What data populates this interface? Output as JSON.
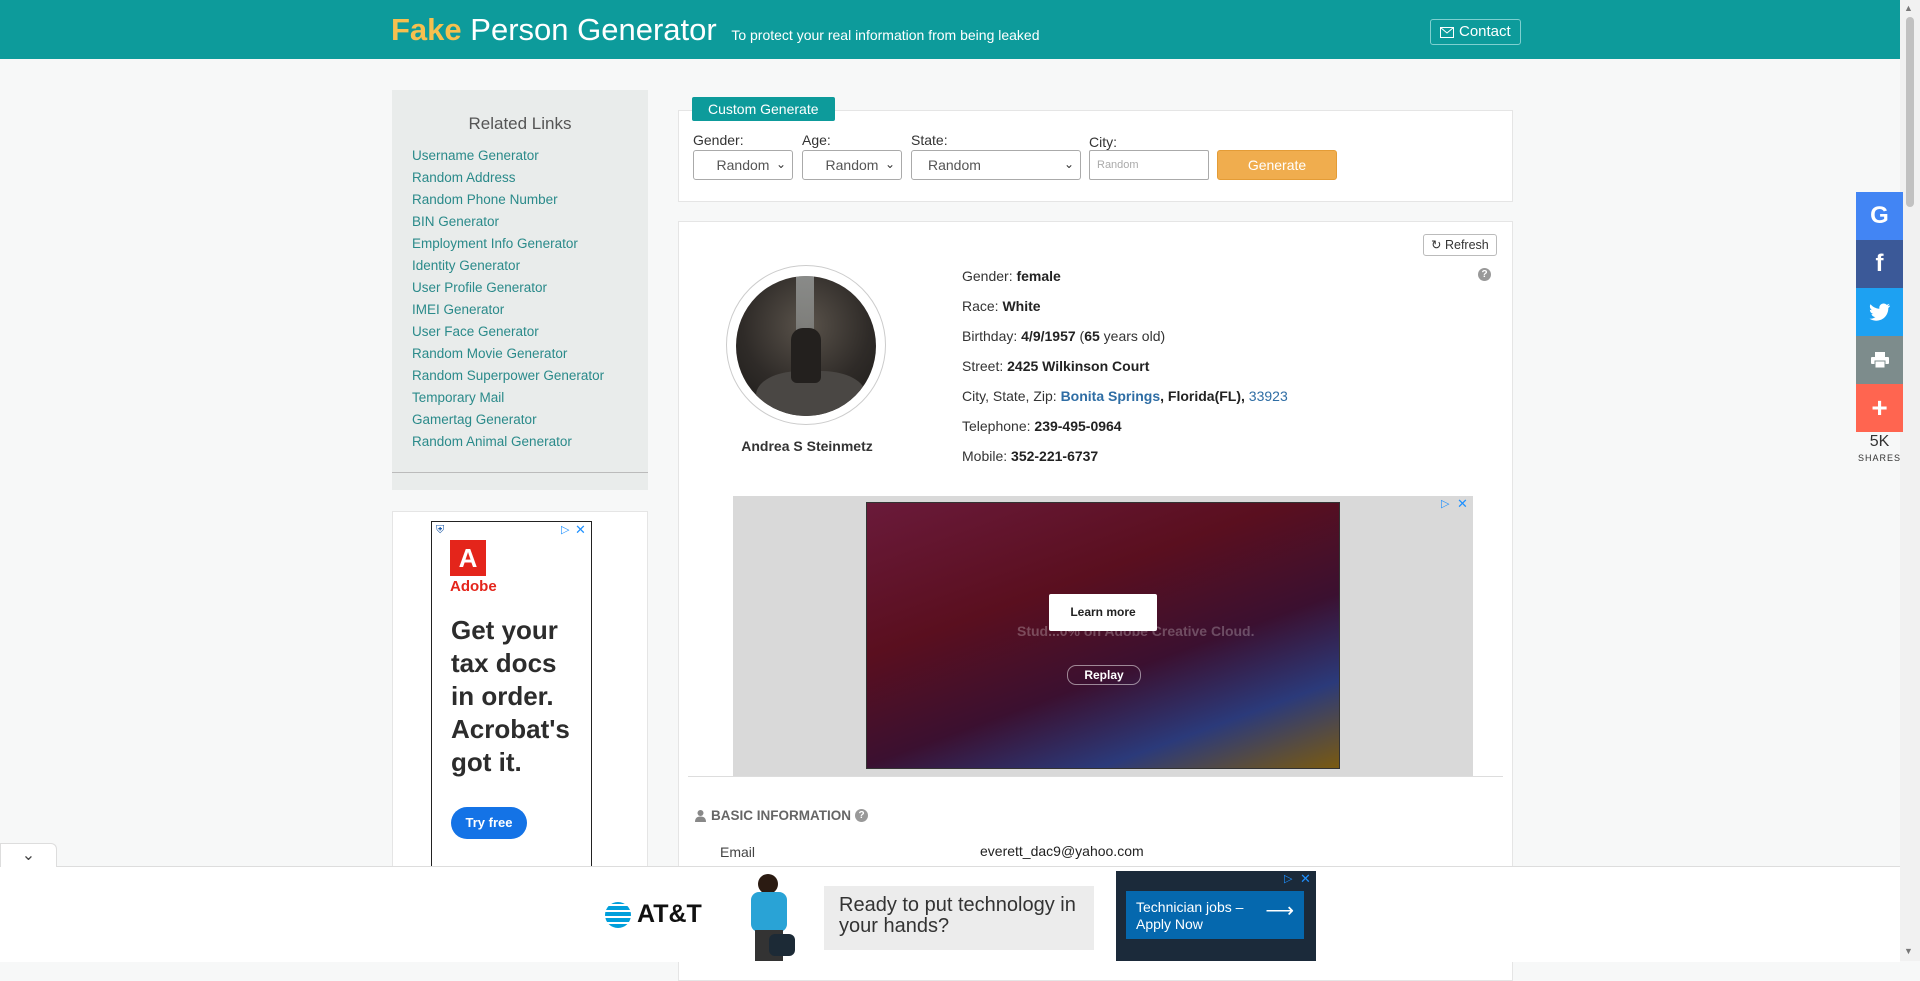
{
  "header": {
    "brand_fake": "Fake",
    "brand_rest": "Person Generator",
    "tagline": "To protect your real information from being leaked",
    "contact_label": "Contact"
  },
  "sidebar": {
    "title": "Related Links",
    "links": [
      "Username Generator",
      "Random Address",
      "Random Phone Number",
      "BIN Generator",
      "Employment Info Generator",
      "Identity Generator",
      "User Profile Generator",
      "IMEI Generator",
      "User Face Generator",
      "Random Movie Generator",
      "Random Superpower Generator",
      "Temporary Mail",
      "Gamertag Generator",
      "Random Animal Generator"
    ]
  },
  "side_ad": {
    "brand": "Adobe",
    "headline": "Get your tax docs in order. Acrobat's got it.",
    "cta": "Try free"
  },
  "custom_generate": {
    "tab_label": "Custom Generate",
    "gender_label": "Gender:",
    "gender_value": "Random",
    "age_label": "Age:",
    "age_value": "Random",
    "state_label": "State:",
    "state_value": "Random",
    "city_label": "City:",
    "city_placeholder": "Random",
    "generate_label": "Generate"
  },
  "person": {
    "refresh_label": "Refresh",
    "name": "Andrea S Steinmetz",
    "gender_label": "Gender:",
    "gender": "female",
    "race_label": "Race:",
    "race": "White",
    "birthday_label": "Birthday:",
    "birthday": "4/9/1957",
    "age": "65",
    "age_suffix": "years old",
    "street_label": "Street:",
    "street": "2425 Wilkinson Court",
    "csz_label": "City, State, Zip:",
    "city": "Bonita Springs",
    "state": "Florida(FL),",
    "zip": "33923",
    "telephone_label": "Telephone:",
    "telephone": "239-495-0964",
    "mobile_label": "Mobile:",
    "mobile": "352-221-6737"
  },
  "video_ad": {
    "learn_more": "Learn more",
    "replay": "Replay",
    "faint_text": "Stud...0% on Adobe Creative Cloud."
  },
  "basic_info": {
    "title": "BASIC INFORMATION",
    "email_label": "Email",
    "email": "everett_dac9@yahoo.com"
  },
  "share": {
    "count": "5K",
    "label": "SHARES",
    "colors": {
      "google": "#4285f4",
      "facebook": "#3b5998",
      "twitter": "#1da1f2",
      "print": "#7d8c8c",
      "more": "#ff6550"
    }
  },
  "bottom_ad": {
    "brand": "AT&T",
    "message": "Ready to put technology in your hands?",
    "cta": "Technician jobs – Apply Now"
  },
  "colors": {
    "teal": "#0d9b9b",
    "brand_yellow": "#f6c04f",
    "generate_orange": "#f0ad4e",
    "link": "#2a8a8a"
  }
}
